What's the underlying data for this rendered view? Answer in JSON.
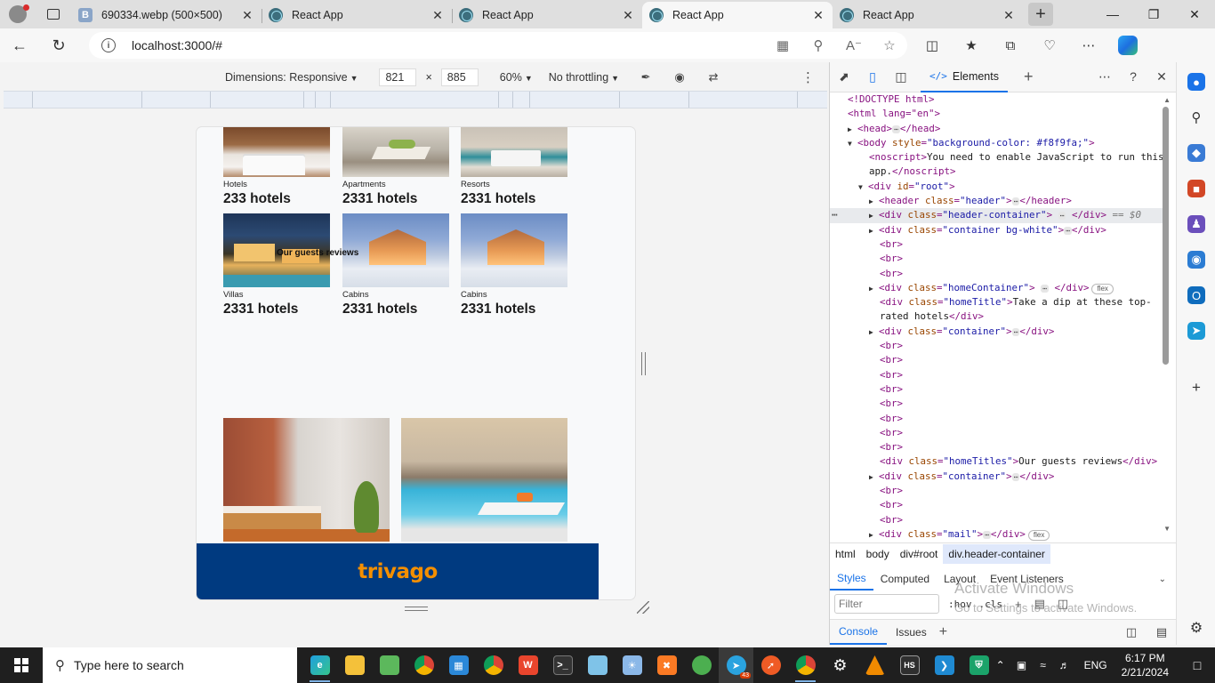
{
  "browser": {
    "tabs": [
      {
        "title": "690334.webp (500×500)",
        "icon": "image-b-icon",
        "active": false
      },
      {
        "title": "React App",
        "icon": "react-icon",
        "active": false
      },
      {
        "title": "React App",
        "icon": "react-icon",
        "active": false
      },
      {
        "title": "React App",
        "icon": "react-icon",
        "active": true
      },
      {
        "title": "React App",
        "icon": "react-icon",
        "active": false
      }
    ],
    "new_tab": "+",
    "close_glyph": "✕",
    "url": "localhost:3000/#"
  },
  "device_toolbar": {
    "dimensions_label": "Dimensions: Responsive",
    "width": "821",
    "height": "885",
    "times": "×",
    "zoom": "60%",
    "throttle": "No throttling"
  },
  "page": {
    "properties_row1": [
      {
        "type": "Hotels",
        "count": "233 hotels"
      },
      {
        "type": "Apartments",
        "count": "2331 hotels"
      },
      {
        "type": "Resorts",
        "count": "2331 hotels"
      }
    ],
    "properties_row2": [
      {
        "type": "Villas",
        "count": "2331 hotels"
      },
      {
        "type": "Cabins",
        "count": "2331 hotels"
      },
      {
        "type": "Cabins",
        "count": "2331 hotels"
      }
    ],
    "overlay_title": "Our guests reviews",
    "footer_logo": "trivago"
  },
  "devtools": {
    "elements_tab": "Elements",
    "dom_lines": {
      "doctype": "<!DOCTYPE html>",
      "html_open": "<html lang=\"en\">",
      "noscript_text": "You need to enable JavaScript to run this app.",
      "home_title_text": "Take a dip at these top-rated hotels",
      "home_titles_text": "Our guests reviews",
      "selected_marker": "== $0",
      "flex_badge": "flex"
    },
    "breadcrumbs": [
      "html",
      "body",
      "div#root",
      "div.header-container"
    ],
    "styles_tabs": [
      "Styles",
      "Computed",
      "Layout",
      "Event Listeners"
    ],
    "filter_placeholder": "Filter",
    "hov": ":hov",
    "cls": ".cls",
    "drawer_tabs": [
      "Console",
      "Issues"
    ],
    "watermark_line1": "Activate Windows",
    "watermark_line2": "Go to Settings to activate Windows."
  },
  "taskbar": {
    "search_placeholder": "Type here to search",
    "language": "ENG",
    "time": "6:17 PM",
    "date": "2/21/2024",
    "telegram_badge": "43"
  }
}
